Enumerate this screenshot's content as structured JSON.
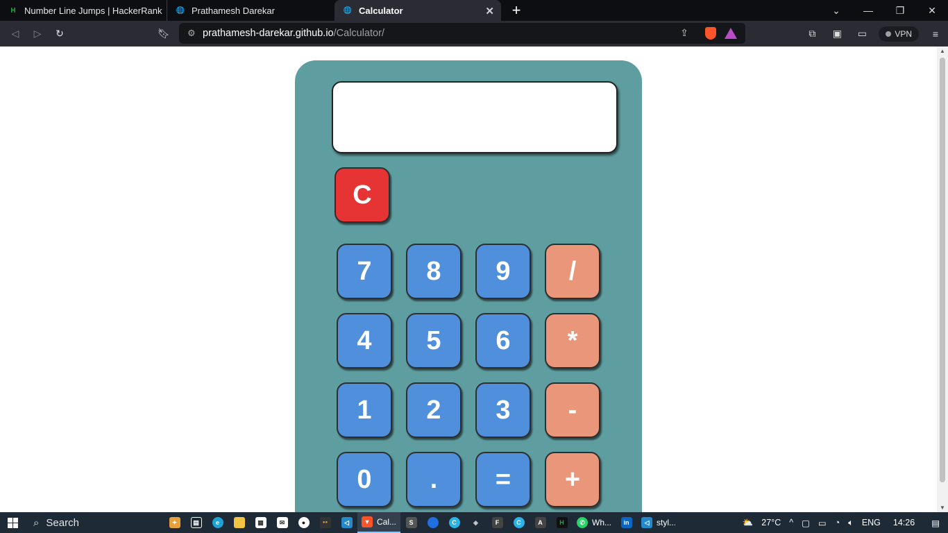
{
  "browser": {
    "tabs": [
      {
        "title": "Number Line Jumps | HackerRank",
        "icon": "hackerrank-icon",
        "active": false
      },
      {
        "title": "Prathamesh Darekar",
        "icon": "globe-icon",
        "active": false
      },
      {
        "title": "Calculator",
        "icon": "globe-icon",
        "active": true
      }
    ],
    "url_host": "prathamesh-darekar.github.io",
    "url_path": "/Calculator/",
    "vpn_label": "VPN"
  },
  "calculator": {
    "display_value": "",
    "clear_label": "C",
    "keys": [
      {
        "label": "7",
        "kind": "num"
      },
      {
        "label": "8",
        "kind": "num"
      },
      {
        "label": "9",
        "kind": "num"
      },
      {
        "label": "/",
        "kind": "op"
      },
      {
        "label": "4",
        "kind": "num"
      },
      {
        "label": "5",
        "kind": "num"
      },
      {
        "label": "6",
        "kind": "num"
      },
      {
        "label": "*",
        "kind": "op"
      },
      {
        "label": "1",
        "kind": "num"
      },
      {
        "label": "2",
        "kind": "num"
      },
      {
        "label": "3",
        "kind": "num"
      },
      {
        "label": "-",
        "kind": "op"
      },
      {
        "label": "0",
        "kind": "num"
      },
      {
        "label": ".",
        "kind": "num"
      },
      {
        "label": "=",
        "kind": "num"
      },
      {
        "label": "+",
        "kind": "op"
      }
    ],
    "colors": {
      "body": "#5f9ea0",
      "number_key": "#4f8fdb",
      "operator_key": "#e9967a",
      "clear_key": "#e63434"
    }
  },
  "taskbar": {
    "search_label": "Search",
    "apps": [
      {
        "label": "Cal...",
        "icon": "brave-icon",
        "active": true
      },
      {
        "label": "Wh...",
        "icon": "whatsapp-icon",
        "active": false
      },
      {
        "label": "styl...",
        "icon": "vscode-icon",
        "active": false
      }
    ],
    "weather": "27°C",
    "language": "ENG",
    "time": "14:26"
  }
}
